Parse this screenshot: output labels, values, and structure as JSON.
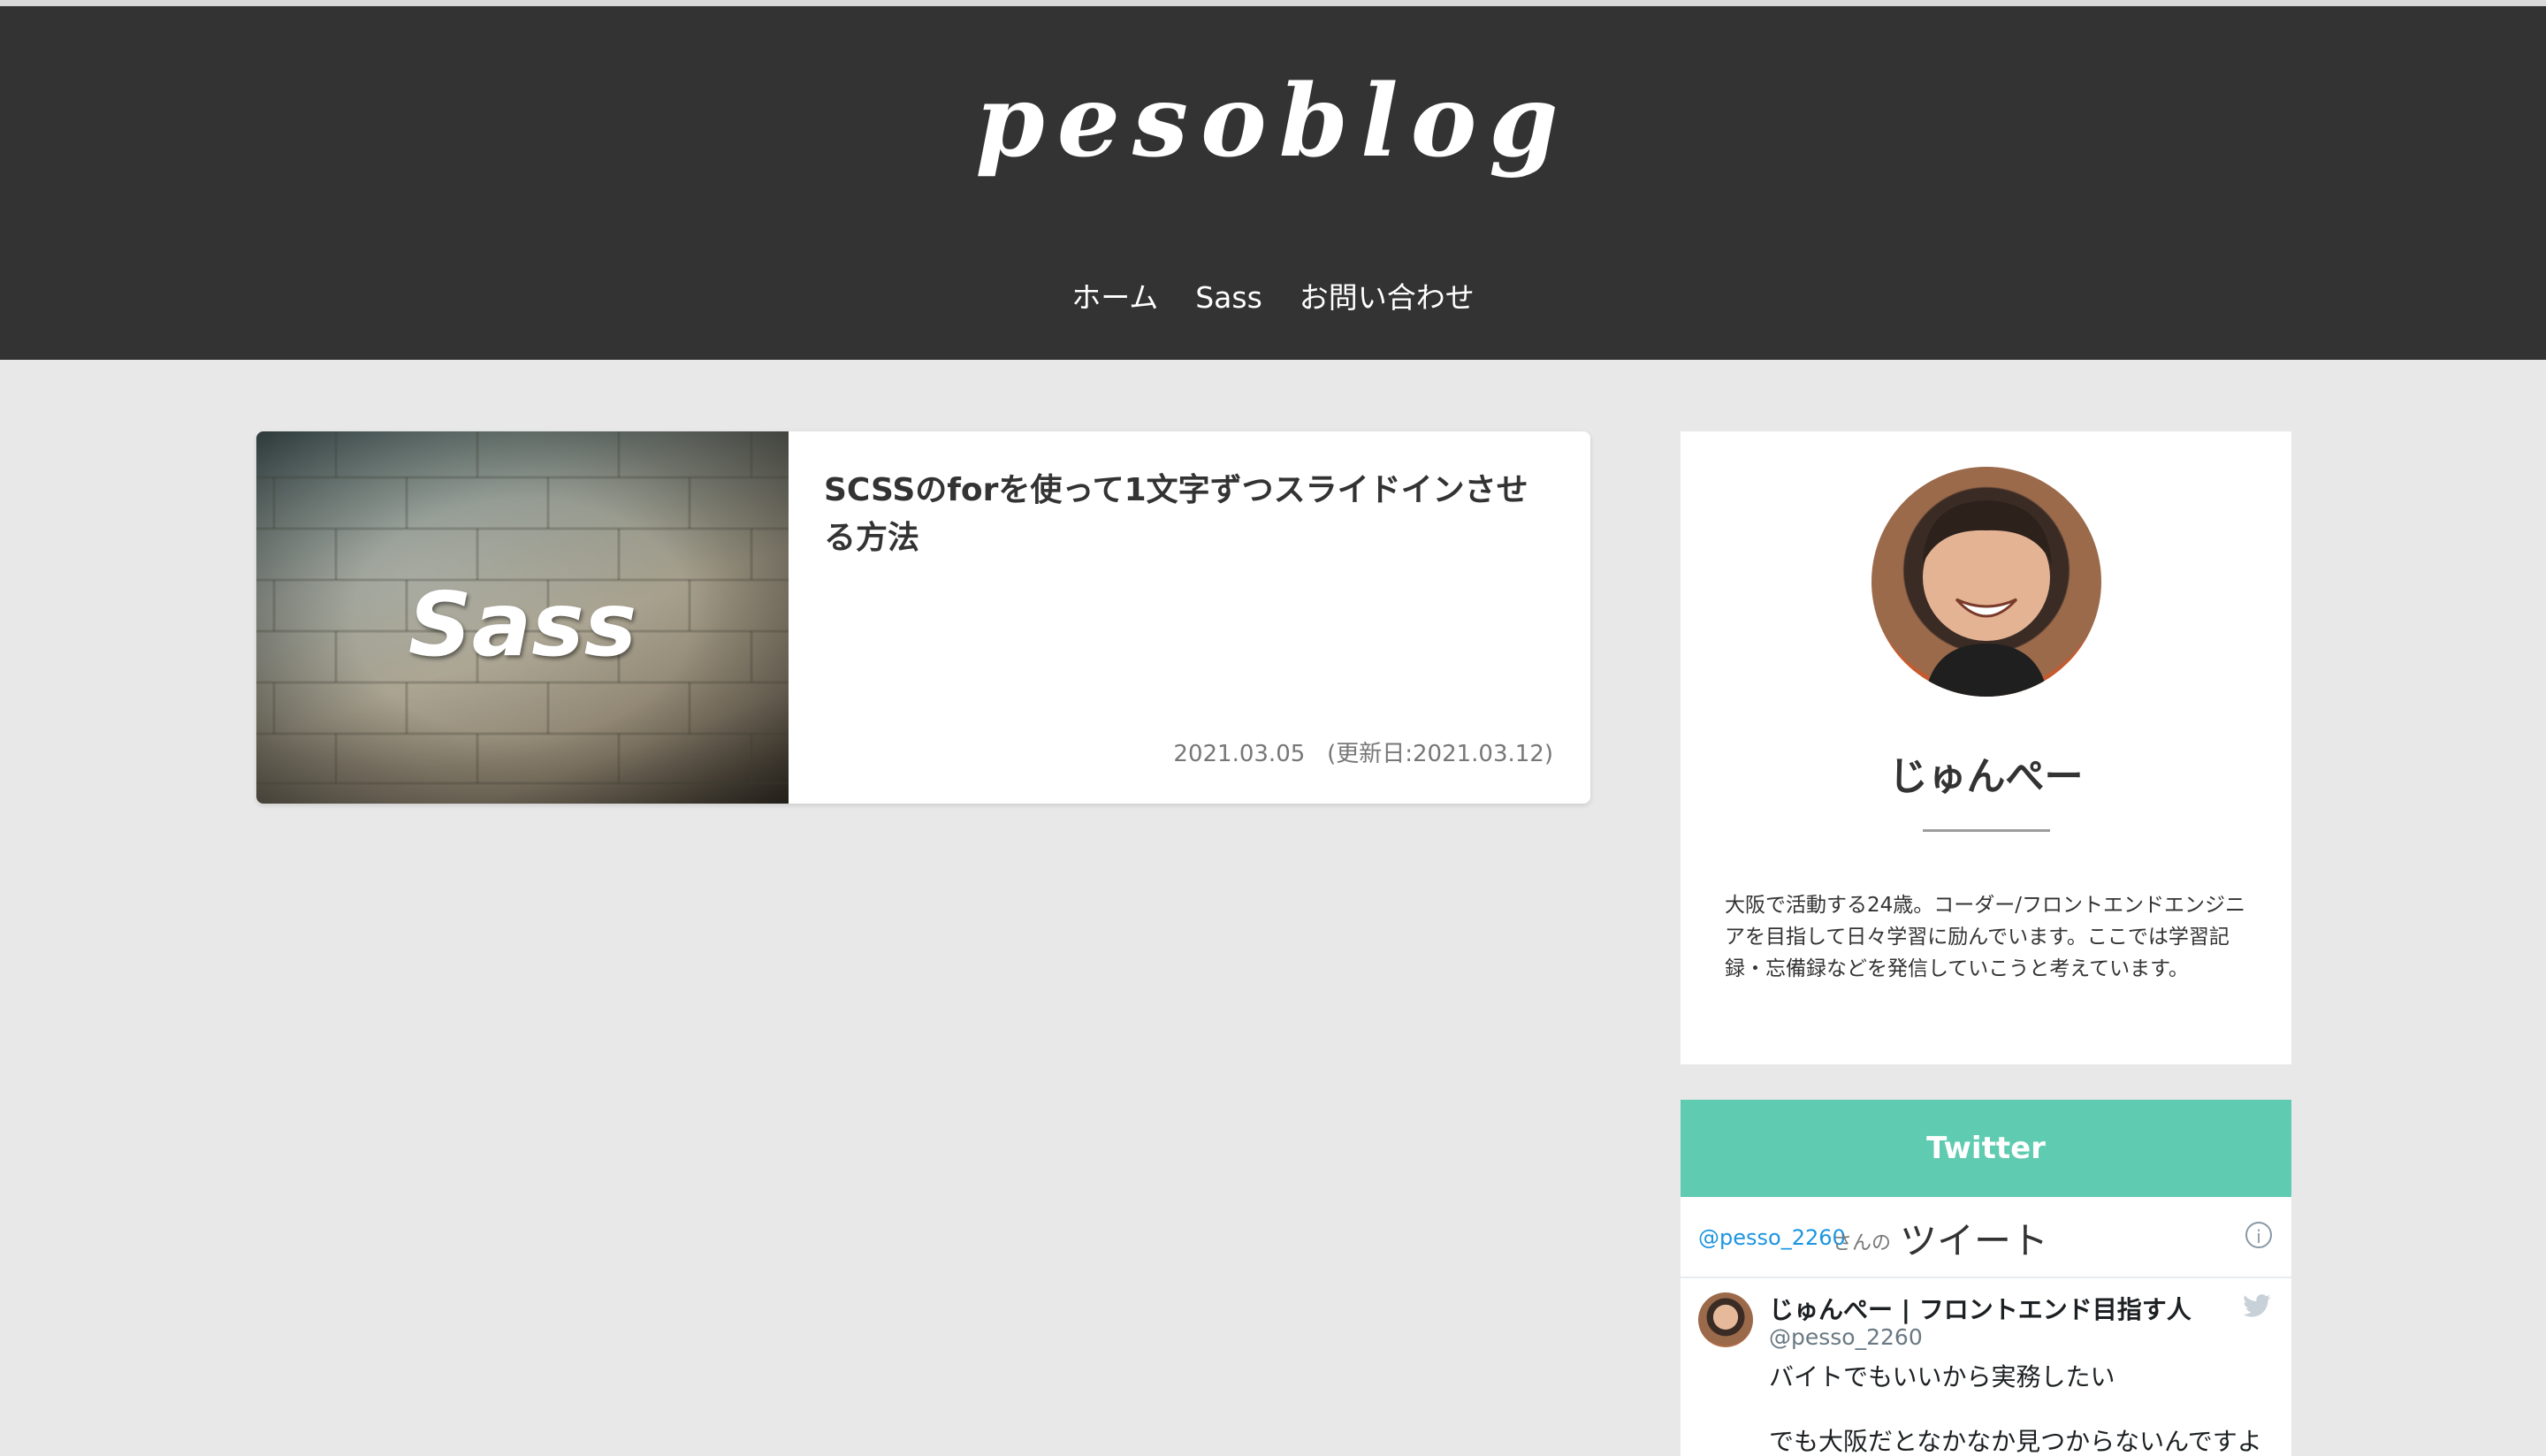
{
  "site": {
    "logo": "pesoblog"
  },
  "nav": {
    "items": [
      {
        "label": "ホーム"
      },
      {
        "label": "Sass"
      },
      {
        "label": "お問い合わせ"
      }
    ]
  },
  "article": {
    "thumbnail_text": "Sass",
    "title": "SCSSのforを使って1文字ずつスライドインさせる方法",
    "date": "2021.03.05",
    "updated": "(更新日:2021.03.12)"
  },
  "profile": {
    "name": "じゅんぺー",
    "bio": "大阪で活動する24歳。コーダー/フロントエンドエンジニアを目指して日々学習に励んでいます。ここでは学習記録・忘備録などを発信していこうと考えています。"
  },
  "twitter": {
    "header": "Twitter",
    "handle_link": "@pesso_2260",
    "san_no": "さんの",
    "timeline_title": "ツイート",
    "info_symbol": "i",
    "tweet": {
      "author": "じゅんぺー | フロントエンド目指す人",
      "handle": "@pesso_2260",
      "text_line1": "バイトでもいいから実務したい",
      "text_line2": "でも大阪だとなかなか見つからないんですよ"
    }
  },
  "colors": {
    "header_bg": "#333333",
    "page_bg": "#e8e8e8",
    "twitter_accent": "#5fcbb0"
  }
}
